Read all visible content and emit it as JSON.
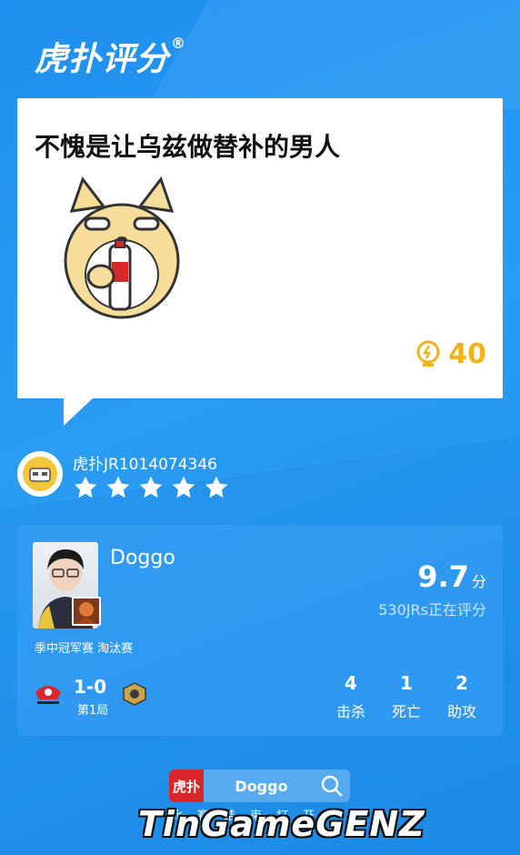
{
  "header": {
    "logo_text": "虎扑评分",
    "registered_mark": "®"
  },
  "comment": {
    "text": "不愧是让乌兹做替补的男人",
    "likes": "40"
  },
  "user": {
    "name": "虎扑JR1014074346",
    "rating_stars": 5
  },
  "player": {
    "name": "Doggo",
    "score": "9.7",
    "score_unit": "分",
    "raters": "530JRs正在评分",
    "match_tag": "季中冠军赛 淘汰赛",
    "match_score": "1-0",
    "match_round": "第1局",
    "stats": [
      {
        "value": "4",
        "label": "击杀"
      },
      {
        "value": "1",
        "label": "死亡"
      },
      {
        "value": "2",
        "label": "助攻"
      }
    ]
  },
  "search": {
    "logo_text": "虎扑",
    "query": "Doggo",
    "hint": "比赛结束打开"
  },
  "watermark": "TinGameGENZ",
  "colors": {
    "accent": "#2a9cf2",
    "gold": "#f3b21c",
    "star": "#ffffff",
    "hupu_red": "#d8262b"
  }
}
